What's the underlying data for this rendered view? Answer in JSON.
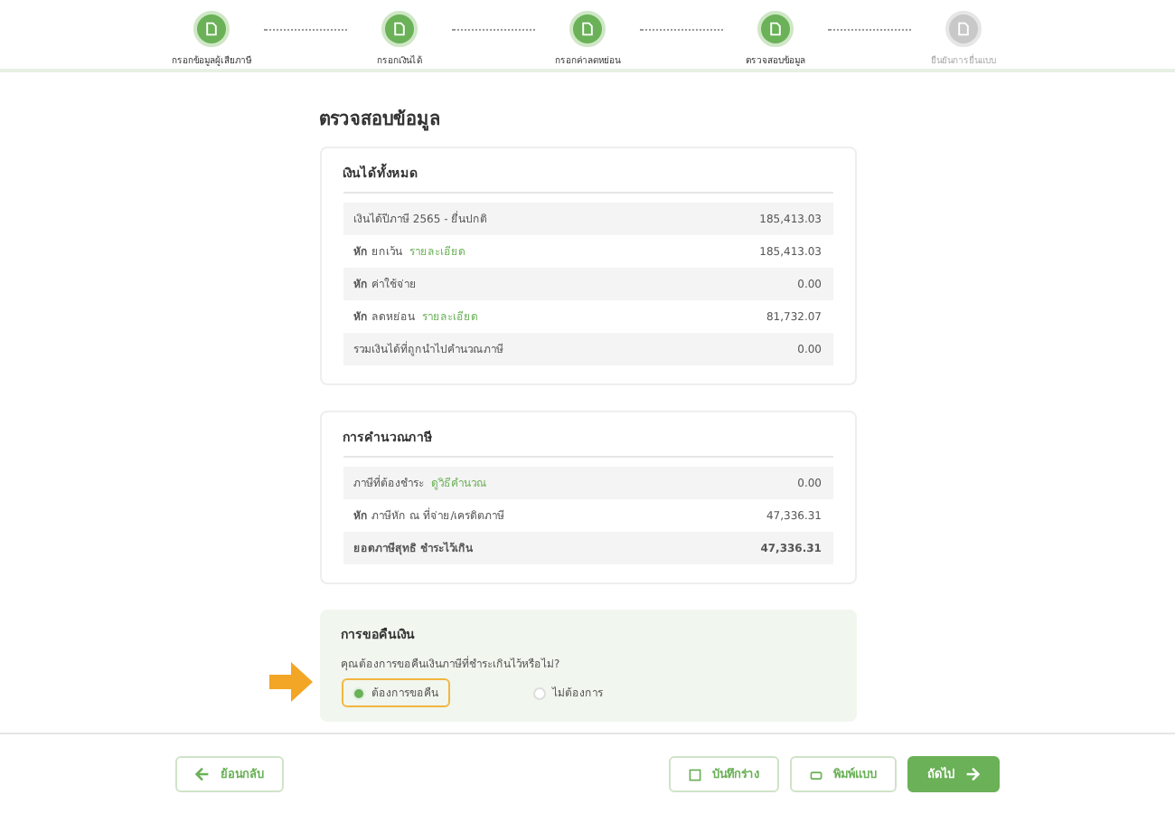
{
  "steps": [
    {
      "label": "กรอกข้อมูลผู้เสียภาษี",
      "done": true
    },
    {
      "label": "กรอกเงินได้",
      "done": true
    },
    {
      "label": "กรอกค่าลดหย่อน",
      "done": true
    },
    {
      "label": "ตรวจสอบข้อมูล",
      "done": true
    },
    {
      "label": "ยืนยันการยื่นแบบ",
      "done": false
    }
  ],
  "page_title": "ตรวจสอบข้อมูล",
  "cards": [
    {
      "title": "เงินได้ทั้งหมด",
      "rows": [
        {
          "kind": "plain",
          "label": "เงินได้ปีภาษี 2565 - ยื่นปกติ",
          "value": "185,413.03"
        },
        {
          "kind": "plain",
          "label": "**หัก** ยกเว้น",
          "link": "รายละเอียด",
          "value": "185,413.03"
        },
        {
          "kind": "plain",
          "label": "**หัก** ค่าใช้จ่าย",
          "value": "0.00"
        },
        {
          "kind": "plain",
          "label": "**หัก** ลดหย่อน",
          "link": "รายละเอียด",
          "value": "81,732.07"
        },
        {
          "kind": "plain",
          "label": "รวมเงินได้ที่ถูกนำไปคำนวณภาษี",
          "value": "0.00"
        }
      ]
    },
    {
      "title": "การคำนวณภาษี",
      "rows": [
        {
          "kind": "plain",
          "label": "ภาษีที่ต้องชำระ",
          "link": "ดูวิธีคำนวณ",
          "value": "0.00"
        },
        {
          "kind": "plain",
          "label": "**หัก** ภาษีหัก ณ ที่จ่าย/เครดิตภาษี",
          "value": "47,336.31"
        },
        {
          "kind": "total",
          "label": "ยอดภาษีสุทธิ ชำระไว้เกิน",
          "value": "47,336.31"
        }
      ]
    }
  ],
  "refund": {
    "title": "การขอคืนเงิน",
    "question": "คุณต้องการขอคืนเงินภาษีที่ชำระเกินไว้หรือไม่?",
    "options": [
      {
        "label": "ต้องการขอคืน",
        "selected": true,
        "highlighted": true
      },
      {
        "label": "ไม่ต้องการ",
        "selected": false,
        "highlighted": false
      }
    ]
  },
  "footer": {
    "back": "ย้อนกลับ",
    "save": "บันทึกร่าง",
    "print": "พิมพ์แบบ",
    "next": "ถัดไป"
  }
}
